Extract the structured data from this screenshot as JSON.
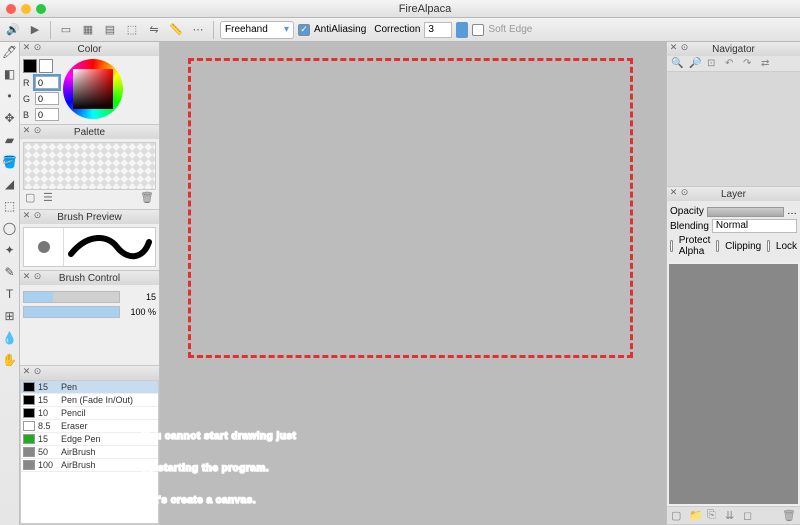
{
  "title": "FireAlpaca",
  "toolbar": {
    "mode": "Freehand",
    "antialias_label": "AntiAliasing",
    "antialias_checked": true,
    "correction_label": "Correction",
    "correction_value": "3",
    "softedge_label": "Soft Edge",
    "softedge_checked": false
  },
  "panels": {
    "color": {
      "title": "Color",
      "r": "0",
      "g": "0",
      "b": "0",
      "fg": "#000000",
      "bg": "#ffffff"
    },
    "palette": {
      "title": "Palette"
    },
    "brush_preview": {
      "title": "Brush Preview"
    },
    "brush_control": {
      "title": "Brush Control",
      "size": "15",
      "opacity": "100 %"
    },
    "navigator": {
      "title": "Navigator"
    },
    "layer": {
      "title": "Layer",
      "opacity_label": "Opacity",
      "blending_label": "Blending",
      "blending_value": "Normal",
      "protect_label": "Protect Alpha",
      "clipping_label": "Clipping",
      "lock_label": "Lock"
    }
  },
  "brushes": [
    {
      "size": "15",
      "name": "Pen",
      "swatch": "#000000",
      "selected": true
    },
    {
      "size": "15",
      "name": "Pen (Fade In/Out)",
      "swatch": "#000000"
    },
    {
      "size": "10",
      "name": "Pencil",
      "swatch": "#000000"
    },
    {
      "size": "8.5",
      "name": "Eraser",
      "swatch": "#ffffff"
    },
    {
      "size": "15",
      "name": "Edge Pen",
      "swatch": "#22aa22"
    },
    {
      "size": "50",
      "name": "AirBrush",
      "swatch": "#888888"
    },
    {
      "size": "100",
      "name": "AirBrush",
      "swatch": "#888888"
    }
  ],
  "overlay": {
    "line1": "You cannot start drawing just",
    "line2": "by starting the program.",
    "line3": "Let's create a canvas."
  }
}
